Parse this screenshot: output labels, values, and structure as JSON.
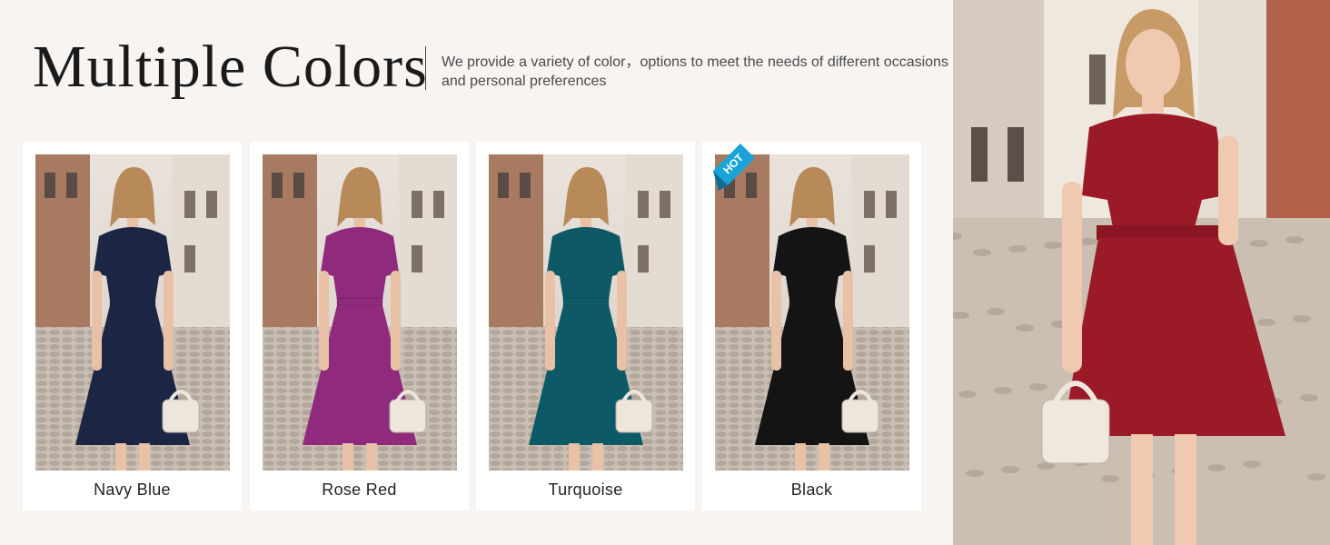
{
  "header": {
    "title": "Multiple Colors",
    "subtitle": "We provide a variety of color，options to meet the needs of different occasions and personal preferences"
  },
  "colors": [
    {
      "name": "Navy Blue",
      "hex": "#1c2544"
    },
    {
      "name": "Rose Red",
      "hex": "#8f2a7c"
    },
    {
      "name": "Turquoise",
      "hex": "#0d5a66"
    },
    {
      "name": "Black",
      "hex": "#141414",
      "badge": "HOT"
    }
  ],
  "hero": {
    "dress_hex": "#9b1a28"
  },
  "theme": {
    "background": "#f7f4f2",
    "badge_color": "#1aa3d9"
  }
}
